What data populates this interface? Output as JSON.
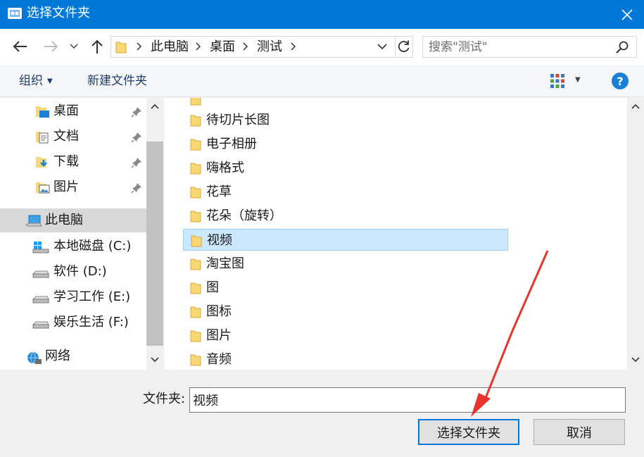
{
  "window": {
    "title": "选择文件夹",
    "accent_color": "#0078d7",
    "close_icon": "close-icon"
  },
  "address_bar": {
    "breadcrumbs": [
      "此电脑",
      "桌面",
      "测试"
    ],
    "search_placeholder": "搜索\"测试\""
  },
  "toolbar": {
    "organize_label": "组织",
    "new_folder_label": "新建文件夹",
    "help_label": "?"
  },
  "nav_pane": {
    "items": [
      {
        "label": "桌面",
        "icon": "desktop-folder-icon",
        "pinned": true
      },
      {
        "label": "文档",
        "icon": "documents-folder-icon",
        "pinned": true
      },
      {
        "label": "下载",
        "icon": "downloads-folder-icon",
        "pinned": true
      },
      {
        "label": "图片",
        "icon": "pictures-folder-icon",
        "pinned": true
      },
      {
        "label": "此电脑",
        "icon": "computer-icon",
        "selected": true
      },
      {
        "label": "本地磁盘 (C:)",
        "icon": "windows-drive-icon"
      },
      {
        "label": "软件 (D:)",
        "icon": "drive-icon"
      },
      {
        "label": "学习工作 (E:)",
        "icon": "drive-icon"
      },
      {
        "label": "娱乐生活 (F:)",
        "icon": "drive-icon"
      },
      {
        "label": "网络",
        "icon": "network-icon"
      }
    ]
  },
  "file_list": {
    "items": [
      {
        "label": "待切片长图"
      },
      {
        "label": "电子相册"
      },
      {
        "label": "嗨格式"
      },
      {
        "label": "花草"
      },
      {
        "label": "花朵（旋转）"
      },
      {
        "label": "视频",
        "selected": true
      },
      {
        "label": "淘宝图"
      },
      {
        "label": "图"
      },
      {
        "label": "图标"
      },
      {
        "label": "图片"
      },
      {
        "label": "音频"
      }
    ]
  },
  "footer": {
    "folder_label": "文件夹:",
    "folder_value": "视频",
    "select_button": "选择文件夹",
    "cancel_button": "取消"
  },
  "annotation": {
    "arrow_color": "#e8342e"
  }
}
